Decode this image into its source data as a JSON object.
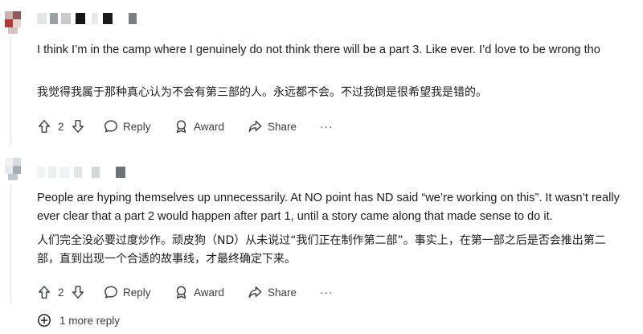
{
  "comments": [
    {
      "body_en": "I think I’m in the camp where I genuinely do not think there will be a part 3. Like ever. I’d love to be wrong tho",
      "body_zh": "我觉得我属于那种真心认为不会有第三部的人。永远都不会。不过我倒是很希望我是错的。",
      "votes": "2",
      "reply_label": "Reply",
      "award_label": "Award",
      "share_label": "Share",
      "more_label": "···"
    },
    {
      "body_en": "People are hyping themselves up unnecessarily. At NO point has ND said “we’re working on this”. It wasn’t really ever clear that a part 2 would happen after part 1, until a story came along that made sense to do it.",
      "body_zh": "人们完全没必要过度炒作。顽皮狗（ND）从未说过“我们正在制作第二部”。事实上，在第一部之后是否会推出第二部，直到出现一个合适的故事线，才最终确定下来。",
      "votes": "2",
      "reply_label": "Reply",
      "award_label": "Award",
      "share_label": "Share",
      "more_label": "···"
    }
  ],
  "more_replies_label": "1 more reply",
  "icons": {
    "upvote": "arrow-up-icon",
    "downvote": "arrow-down-icon",
    "reply": "speech-bubble-icon",
    "award": "award-icon",
    "share": "share-arrow-icon",
    "more_replies": "plus-circle-icon"
  },
  "colors": {
    "text": "#1c1c1c",
    "action_text": "#3c4043",
    "thread_line": "#dfe1e3"
  }
}
